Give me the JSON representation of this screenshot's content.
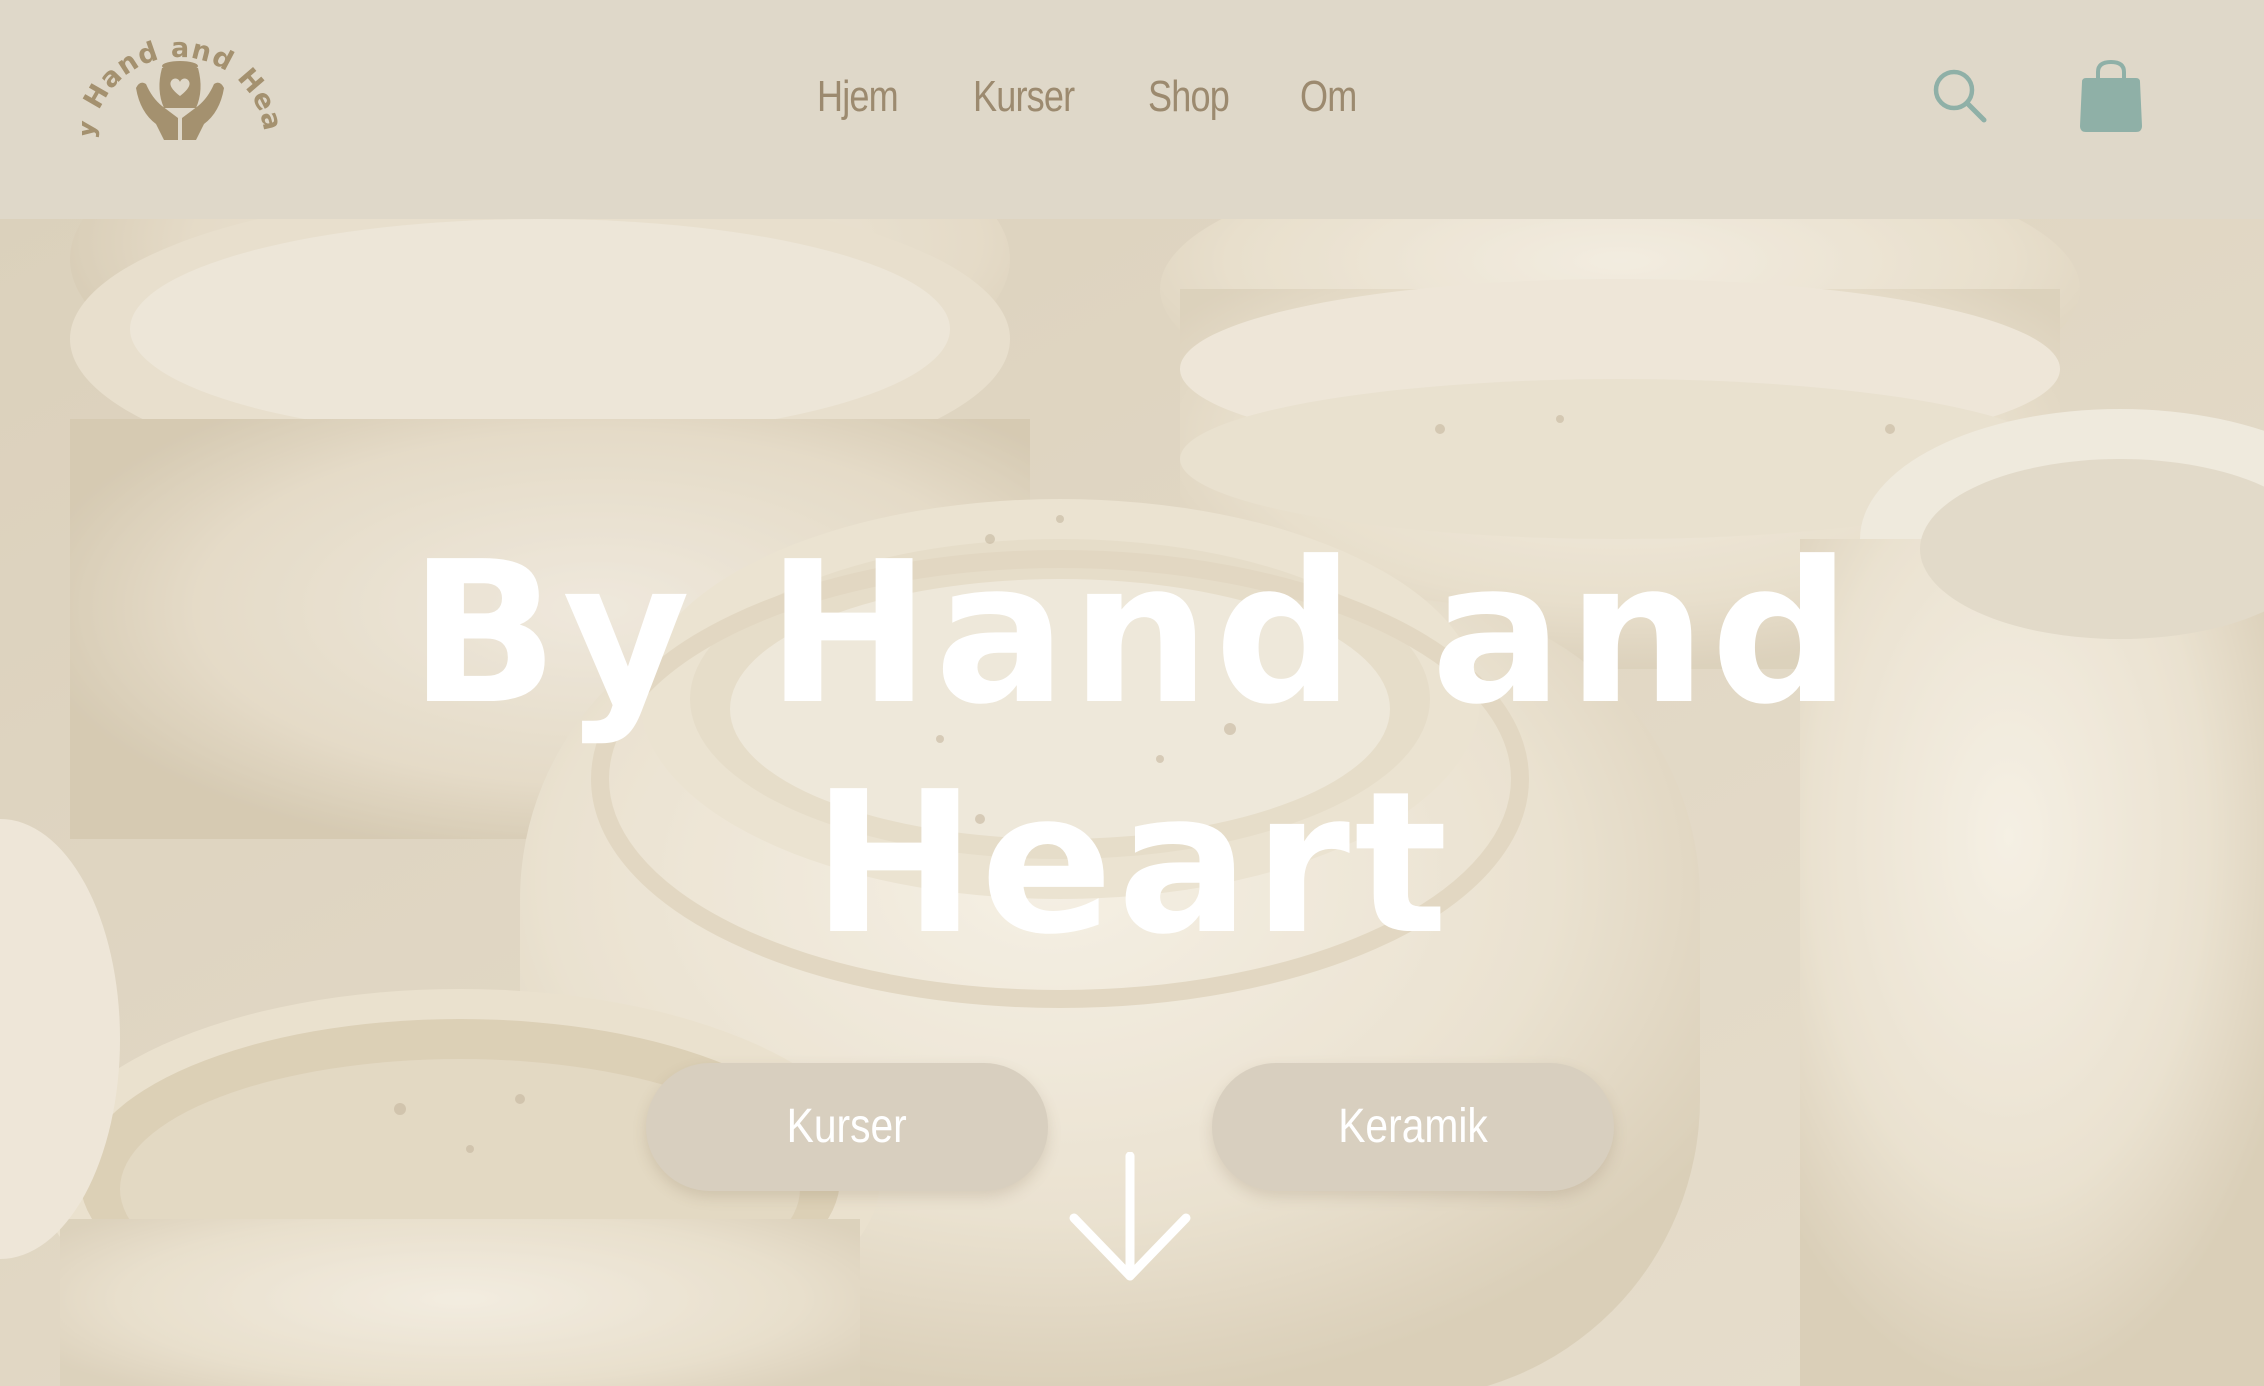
{
  "brand": {
    "logo_text": "By Hand and Heart",
    "logo_icon": "hands-holding-heart-pot"
  },
  "nav": {
    "items": [
      {
        "label": "Hjem"
      },
      {
        "label": "Kurser"
      },
      {
        "label": "Shop"
      },
      {
        "label": "Om"
      }
    ]
  },
  "header_actions": {
    "search_icon": "search-icon",
    "cart_icon": "shopping-bag-icon"
  },
  "hero": {
    "title_line1": "By Hand and",
    "title_line2": "Heart",
    "buttons": [
      {
        "label": "Kurser"
      },
      {
        "label": "Keramik"
      }
    ],
    "scroll_icon": "arrow-down-icon"
  },
  "colors": {
    "header_bg": "#dfd8c9",
    "nav_text": "#9c8a6f",
    "accent_teal": "#8fb0a7",
    "button_bg": "#d8cfbf",
    "hero_text": "#ffffff"
  }
}
